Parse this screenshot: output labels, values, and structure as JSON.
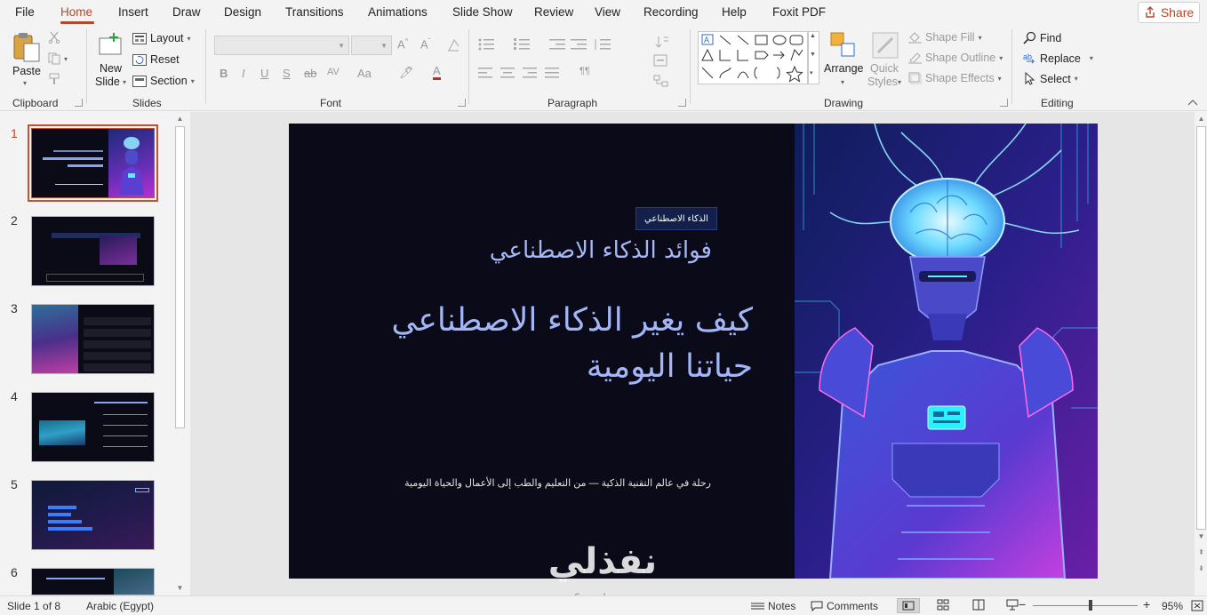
{
  "menu": {
    "items": [
      "File",
      "Home",
      "Insert",
      "Draw",
      "Design",
      "Transitions",
      "Animations",
      "Slide Show",
      "Review",
      "View",
      "Recording",
      "Help",
      "Foxit PDF"
    ],
    "active": "Home",
    "share_label": "Share"
  },
  "ribbon": {
    "clipboard": {
      "paste_label": "Paste",
      "group_label": "Clipboard"
    },
    "slides": {
      "new_slide_line1": "New",
      "new_slide_line2": "Slide",
      "layout_label": "Layout",
      "reset_label": "Reset",
      "section_label": "Section",
      "group_label": "Slides"
    },
    "font": {
      "group_label": "Font",
      "font_name_value": "",
      "font_size_value": ""
    },
    "paragraph": {
      "group_label": "Paragraph"
    },
    "drawing": {
      "arrange_label": "Arrange",
      "quick_styles_line1": "Quick",
      "quick_styles_line2": "Styles",
      "shape_fill_label": "Shape Fill",
      "shape_outline_label": "Shape Outline",
      "shape_effects_label": "Shape Effects",
      "group_label": "Drawing"
    },
    "editing": {
      "find_label": "Find",
      "replace_label": "Replace",
      "select_label": "Select",
      "group_label": "Editing"
    }
  },
  "thumbnails": {
    "numbers": [
      "1",
      "2",
      "3",
      "4",
      "5",
      "6"
    ],
    "active_index": 0
  },
  "slide": {
    "tag": "الذكاء الاصطناعي",
    "subtitle": "فوائد الذكاء الاصطناعي",
    "title": "كيف يغير الذكاء الاصطناعي حياتنا اليومية",
    "tagline": "رحلة في عالم التقنية الذكية — من التعليم والطب إلى الأعمال والحياة اليومية"
  },
  "watermark": {
    "arabic": "نفذلي",
    "latin": "nafeziy.com"
  },
  "status": {
    "slide_indicator": "Slide 1 of 8",
    "language": "Arabic (Egypt)",
    "notes_label": "Notes",
    "comments_label": "Comments",
    "zoom_minus": "−",
    "zoom_plus": "+",
    "zoom_level": "95%"
  },
  "colors": {
    "accent": "#b7472a",
    "slide_bg": "#0a0a18",
    "title": "#a2b6f7"
  }
}
